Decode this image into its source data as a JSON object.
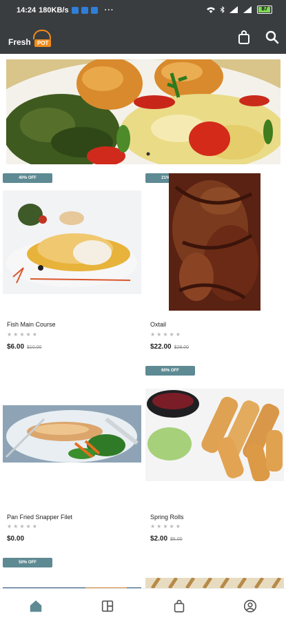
{
  "status_bar": {
    "time": "14:24",
    "speed": "180KB/s",
    "more": "···",
    "battery": "87"
  },
  "app": {
    "logo_text": "Fresh",
    "logo_badge": "POT"
  },
  "products": [
    {
      "name": "Fish Main Course",
      "badge": "40% OFF",
      "price": "$6.00",
      "old_price": "$10.00",
      "rating": 0
    },
    {
      "name": "Oxtail",
      "badge": "21% OFF",
      "price": "$22.00",
      "old_price": "$28.00",
      "rating": 0
    },
    {
      "name": "Pan Fried Snapper Filet",
      "badge": "",
      "price": "$0.00",
      "old_price": "",
      "rating": 0
    },
    {
      "name": "Spring Rolls",
      "badge": "60% OFF",
      "price": "$2.00",
      "old_price": "$5.00",
      "rating": 0
    },
    {
      "name": "",
      "badge": "50% OFF",
      "price": "",
      "old_price": "",
      "rating": 0
    }
  ],
  "stars": "★★★★★",
  "bottom_nav": [
    "home-icon",
    "categories-icon",
    "cart-icon",
    "profile-icon"
  ],
  "colors": {
    "bar": "#3a3d40",
    "badge": "#5e8a93",
    "accent": "#f28c1c",
    "nav_active": "#5e8a93"
  }
}
